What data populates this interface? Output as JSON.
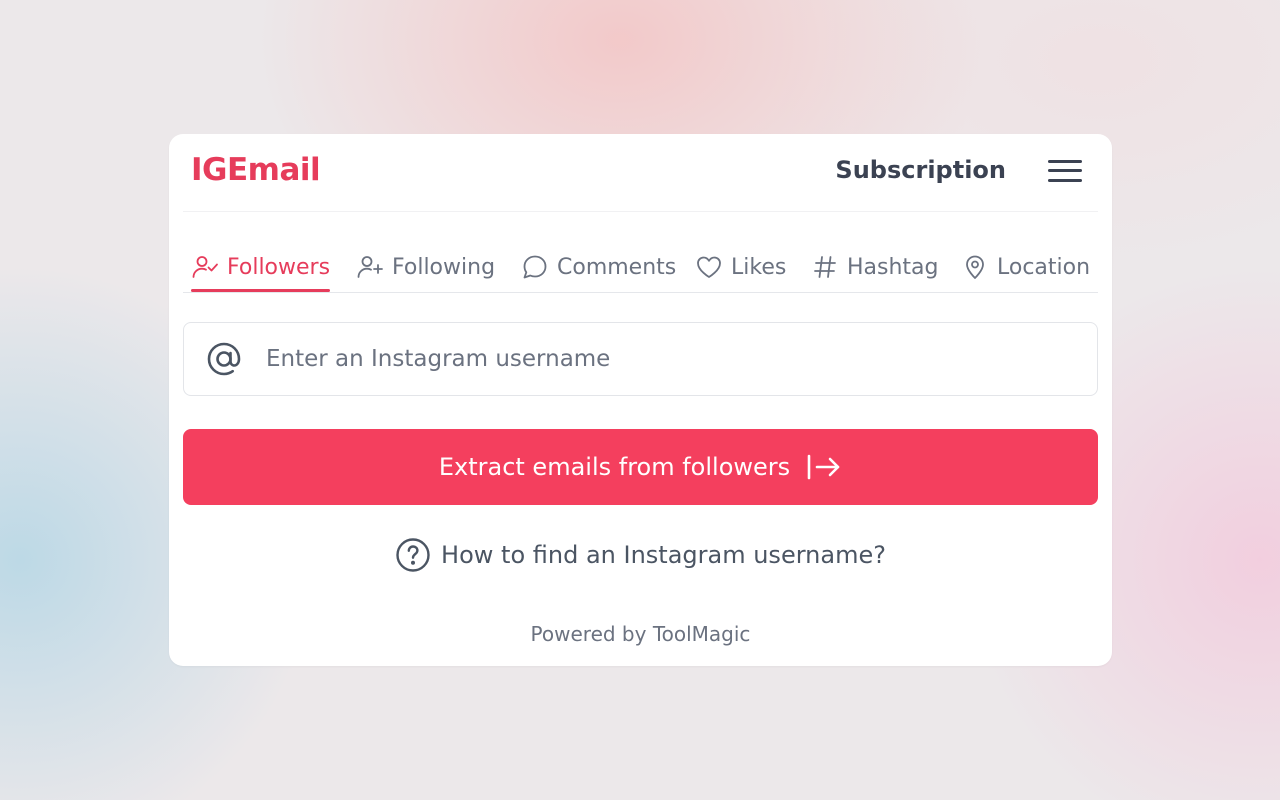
{
  "header": {
    "logo": "IGEmail",
    "subscription_label": "Subscription",
    "menu_icon": "hamburger-menu-icon"
  },
  "tabs": [
    {
      "label": "Followers",
      "icon": "user-check-icon",
      "active": true
    },
    {
      "label": "Following",
      "icon": "user-plus-icon",
      "active": false
    },
    {
      "label": "Comments",
      "icon": "chat-bubble-icon",
      "active": false
    },
    {
      "label": "Likes",
      "icon": "heart-icon",
      "active": false
    },
    {
      "label": "Hashtag",
      "icon": "hash-icon",
      "active": false
    },
    {
      "label": "Location",
      "icon": "map-pin-icon",
      "active": false
    }
  ],
  "search": {
    "placeholder": "Enter an Instagram username",
    "value": "",
    "icon": "at-sign-icon"
  },
  "extract_button": {
    "label": "Extract emails from followers",
    "icon": "arrow-right-to-bracket-icon"
  },
  "help": {
    "label": "How to find an Instagram username?",
    "icon": "question-circle-icon"
  },
  "footer": {
    "powered_by": "Powered by ToolMagic"
  },
  "colors": {
    "accent": "#f43f5e",
    "logo": "#e63c5b",
    "text_dark": "#3b4252",
    "text_muted": "#6b7280"
  }
}
